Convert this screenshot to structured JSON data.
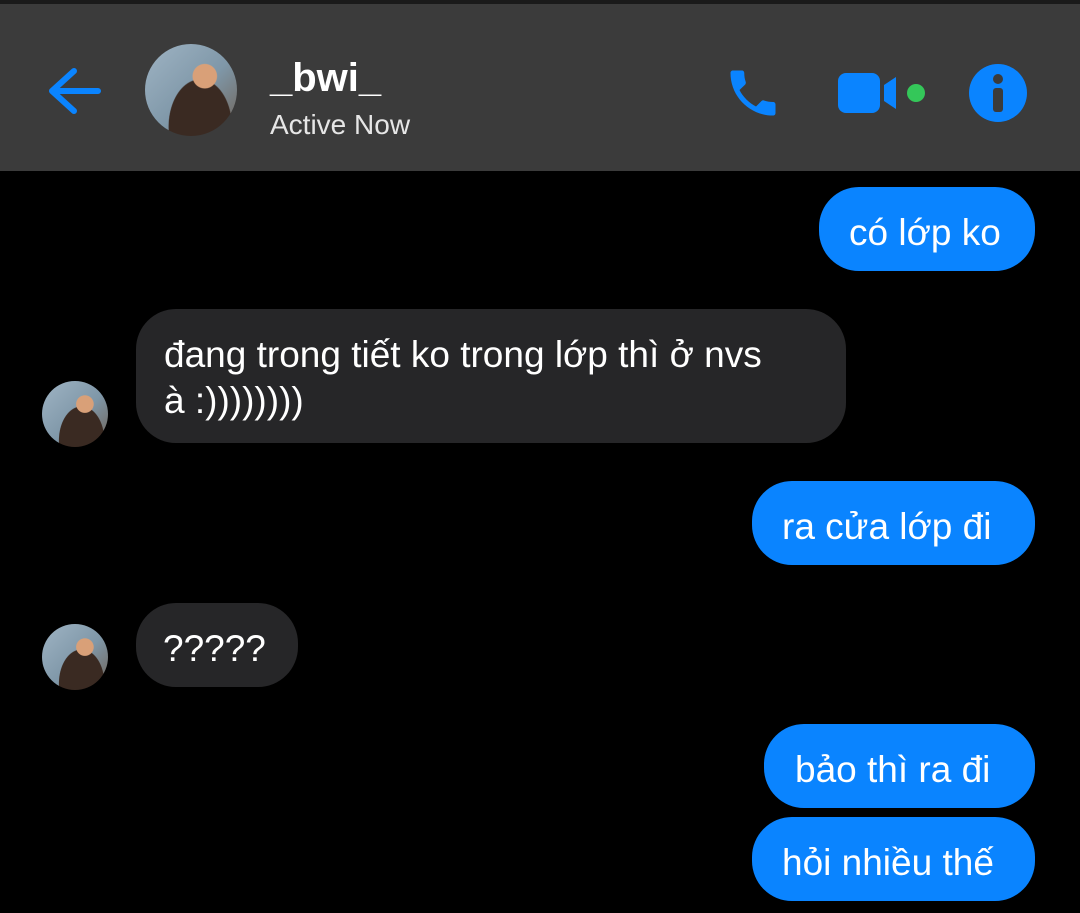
{
  "header": {
    "contact_name": "_bwi_",
    "status": "Active Now",
    "icons": {
      "back": "back-arrow-icon",
      "call": "phone-icon",
      "video": "video-camera-icon",
      "info": "info-icon"
    },
    "colors": {
      "accent": "#0a84ff",
      "active_dot": "#34c759",
      "header_bg": "#3b3b3b"
    }
  },
  "messages": [
    {
      "sender": "me",
      "text": "có lớp ko"
    },
    {
      "sender": "them",
      "line1": "đang trong tiết ko trong lớp thì ở nvs",
      "line2": "à :))))))))"
    },
    {
      "sender": "me",
      "text": "ra cửa lớp đi"
    },
    {
      "sender": "them",
      "text": "?????"
    },
    {
      "sender": "me",
      "text": "bảo thì ra đi"
    },
    {
      "sender": "me",
      "text": "hỏi nhiều thế"
    }
  ],
  "colors": {
    "outgoing_bubble": "#0a84ff",
    "incoming_bubble": "#262628",
    "background": "#000000"
  }
}
